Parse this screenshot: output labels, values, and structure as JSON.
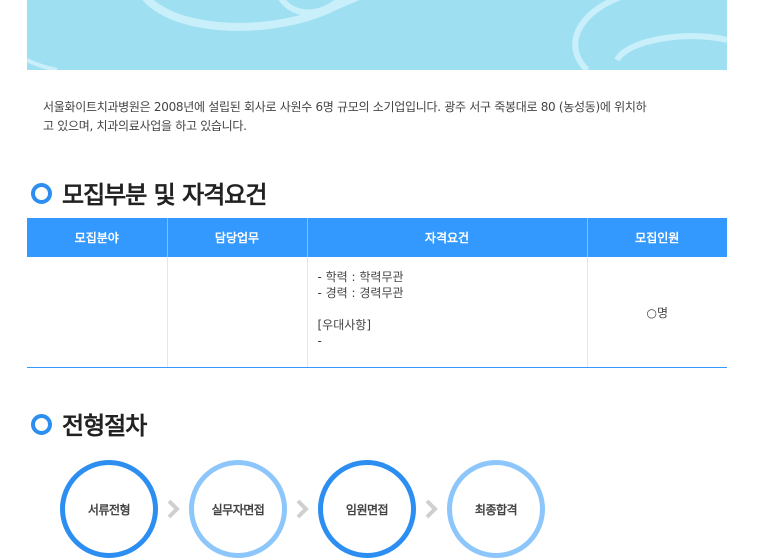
{
  "intro": {
    "line1": "서울화이트치과병원은 2008년에 설립된 회사로 사원수 6명 규모의 소기업입니다. 광주 서구 죽봉대로 80 (농성동)에 위치하",
    "line2": "고 있으며, 치과의료사업을 하고 있습니다."
  },
  "recruit": {
    "title": "모집부분 및 자격요건",
    "headers": [
      "모집분야",
      "담당업무",
      "자격요건",
      "모집인원"
    ],
    "row": {
      "field": "",
      "duty": "",
      "req_lines": [
        "- 학력 : 학력무관",
        "- 경력 : 경력무관",
        "",
        "[우대사항]",
        "-"
      ],
      "count": "○명"
    }
  },
  "process": {
    "title": "전형절차",
    "steps": [
      "서류전형",
      "실무자면접",
      "임원면접",
      "최종합격"
    ]
  },
  "colors": {
    "accent": "#3399ff",
    "banner": "#9ee0f2",
    "ring_light": "#8cc6fa"
  }
}
